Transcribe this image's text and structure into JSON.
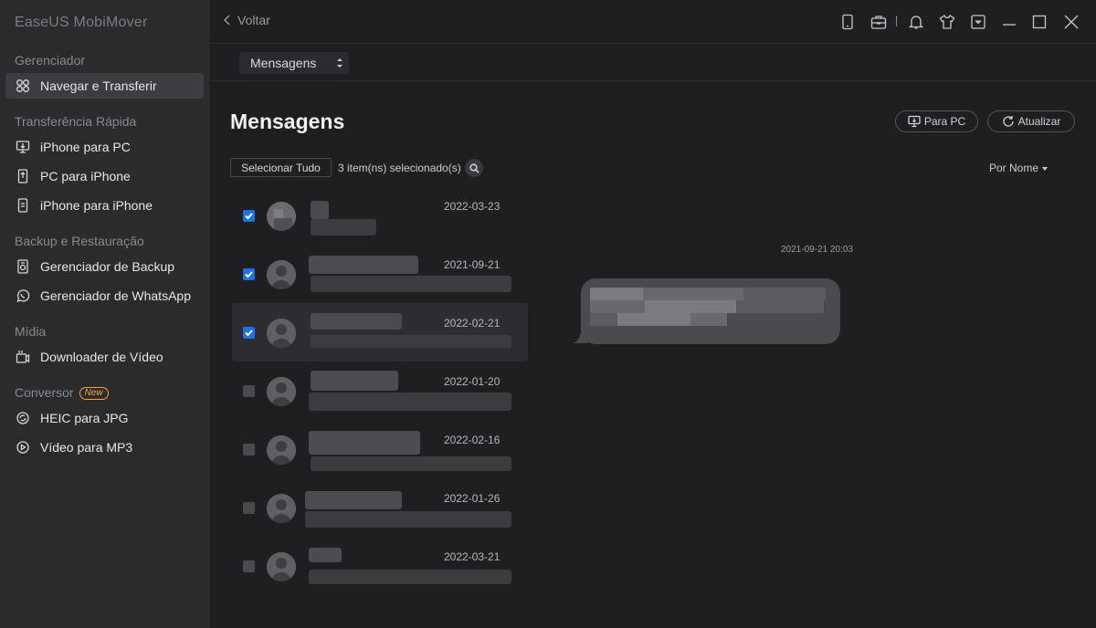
{
  "app_title": "EaseUS MobiMover",
  "sidebar": {
    "sections": [
      {
        "label": "Gerenciador"
      },
      {
        "label": "Transferência Rápida"
      },
      {
        "label": "Backup e Restauração"
      },
      {
        "label": "Mídia"
      },
      {
        "label": "Conversor",
        "badge": "New"
      }
    ],
    "items": [
      {
        "label": "Navegar e Transferir",
        "icon": "grid-icon",
        "active": true
      },
      {
        "label": "iPhone para PC",
        "icon": "phone-to-pc-icon"
      },
      {
        "label": "PC para iPhone",
        "icon": "pc-to-phone-icon"
      },
      {
        "label": "iPhone para iPhone",
        "icon": "phone-to-phone-icon"
      },
      {
        "label": "Gerenciador de Backup",
        "icon": "backup-icon"
      },
      {
        "label": "Gerenciador de WhatsApp",
        "icon": "whatsapp-icon"
      },
      {
        "label": "Downloader de Vídeo",
        "icon": "video-download-icon"
      },
      {
        "label": "HEIC para JPG",
        "icon": "heic-convert-icon"
      },
      {
        "label": "Vídeo para MP3",
        "icon": "video-convert-icon"
      }
    ]
  },
  "topbar": {
    "back_label": "Voltar",
    "icons": [
      "device-icon",
      "toolbox-icon",
      "bell-icon",
      "shirt-icon",
      "dropdown-menu-icon",
      "minimize-icon",
      "maximize-icon",
      "close-icon"
    ]
  },
  "category_select": {
    "value": "Mensagens"
  },
  "main": {
    "title": "Mensagens",
    "to_pc_label": "Para PC",
    "refresh_label": "Atualizar",
    "select_all_label": "Selecionar Tudo",
    "selected_count": "3 item(ns) selecionado(s)",
    "sort_label": "Por Nome"
  },
  "messages": [
    {
      "date": "2022-03-23",
      "checked": true
    },
    {
      "date": "2021-09-21",
      "checked": true
    },
    {
      "date": "2022-02-21",
      "checked": true,
      "highlight": true
    },
    {
      "date": "2022-01-20",
      "checked": false
    },
    {
      "date": "2022-02-16",
      "checked": false
    },
    {
      "date": "2022-01-26",
      "checked": false
    },
    {
      "date": "2022-03-21",
      "checked": false
    }
  ],
  "conversation": {
    "timestamp": "2021-09-21 20:03"
  },
  "colors": {
    "accent": "#1a73e8",
    "badge": "#f4a734",
    "sidebar_bg": "#2b2b2e",
    "main_bg": "#1f1f22"
  }
}
